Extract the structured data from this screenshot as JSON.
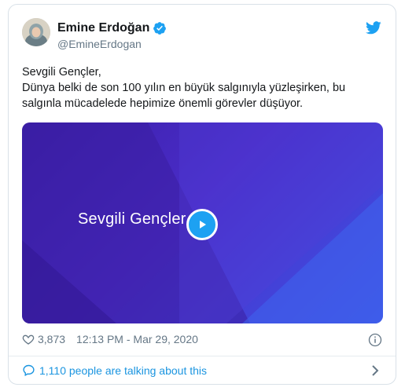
{
  "author": {
    "display_name": "Emine Erdoğan",
    "handle": "@EmineErdogan",
    "verified": true
  },
  "tweet": {
    "lines": [
      "Sevgili Gençler,",
      "Dünya belki de son 100 yılın en büyük salgınıyla yüzleşirken, bu",
      "salgınla mücadelede hepimize önemli görevler düşüyor."
    ]
  },
  "video": {
    "title": "Sevgili Gençler"
  },
  "meta": {
    "likes": "3,873",
    "timestamp": "12:13 PM - Mar 29, 2020"
  },
  "conversation": {
    "label": "1,110 people are talking about this"
  },
  "colors": {
    "twitter_blue": "#1da1f2",
    "link_blue": "#1b95e0",
    "video_purple": "#3a1fa8",
    "video_blue": "#3d55e6",
    "muted_text": "#657786"
  },
  "icons": {
    "logo": "twitter-bird-icon",
    "verified": "verified-badge-icon",
    "like": "heart-icon",
    "info": "info-icon",
    "conversation": "speech-bubble-icon",
    "more": "chevron-right-icon",
    "play": "play-icon"
  }
}
